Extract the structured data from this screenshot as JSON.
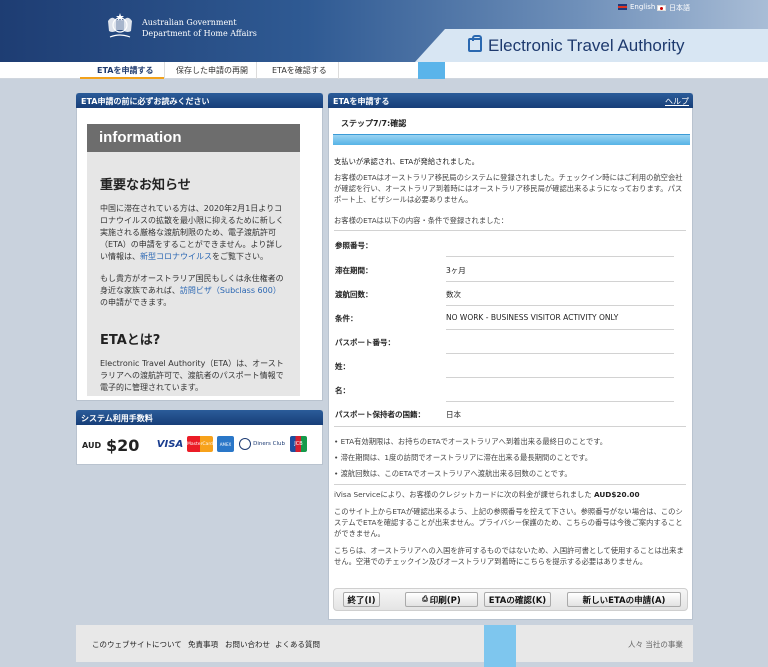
{
  "header": {
    "gov_line1": "Australian Government",
    "gov_line2": "Department of Home Affairs",
    "lang_en": "English",
    "lang_ja": "日本語",
    "app_title": "Electronic Travel Authority"
  },
  "nav": {
    "items": [
      "ETAを申請する",
      "保存した申請の再開",
      "ETAを確認する"
    ]
  },
  "left": {
    "panel_title": "ETA申請の前に必ずお読みください",
    "banner": "information",
    "notice_heading": "重要なお知らせ",
    "notice_p1": "中国に滞在されている方は、2020年2月1日よりコロナウイルスの拡散を最小限に抑えるために新しく実施される厳格な渡航制限のため、電子渡航許可（ETA）の申請をすることができません。より詳しい情報は、",
    "notice_link1": "新型コロナウイルス",
    "notice_p1_end": "をご覧下さい。",
    "notice_p2": "もし貴方がオーストラリア国民もしくは永住権者の身近な家族であれば、",
    "notice_link2": "訪問ビザ（Subclass 600）",
    "notice_p2_end": "の申請ができます。",
    "eta_heading": "ETAとは?",
    "eta_p": "Electronic Travel Authority（ETA）は、オーストラリアへの渡航許可で、渡航者のパスポート情報で電子的に管理されています。"
  },
  "fee": {
    "panel_title": "システム利用手数料",
    "currency": "AUD",
    "amount": "$20",
    "cards": [
      "VISA",
      "MasterCard",
      "AMEX",
      "Diners Club",
      "JCB"
    ]
  },
  "right": {
    "panel_title": "ETAを申請する",
    "help": "ヘルプ",
    "step": "ステップ7/7:確認",
    "progress_percent": 100,
    "msg_approved": "支払いが承認され、ETAが発給されました。",
    "msg_registered": "お客様のETAはオーストラリア移民局のシステムに登録されました。チェックイン時にはご利用の航空会社が確認を行い、オーストラリア到着時にはオーストラリア移民局が確認出来るようになっております。パスポート上、ビザシールは必要ありません。",
    "msg_conditions": "お客様のETAは以下の内容・条件で登録されました：",
    "rows": [
      {
        "label": "参照番号：",
        "value": ""
      },
      {
        "label": "滞在期間：",
        "value": "3ヶ月"
      },
      {
        "label": "渡航回数：",
        "value": "数次"
      },
      {
        "label": "条件：",
        "value": "NO WORK - BUSINESS VISITOR ACTIVITY ONLY"
      },
      {
        "label": "パスポート番号：",
        "value": ""
      },
      {
        "label": "姓：",
        "value": ""
      },
      {
        "label": "名：",
        "value": ""
      },
      {
        "label": "パスポート保持者の国籍：",
        "value": "日本"
      }
    ],
    "bullets": [
      "ETA有効期限は、お持ちのETAでオーストラリアへ到着出来る最終日のことです。",
      "滞在期間は、1度の訪問でオーストラリアに滞在出来る最長期間のことです。",
      "渡航回数は、このETAでオーストラリアへ渡航出来る回数のことです。"
    ],
    "charge_text": "iVisa Serviceにより、お客様のクレジットカードに次の料金が課せられました",
    "charge_amount": "AUD$20.00",
    "note1": "このサイト上からETAが確認出来るよう、上記の参照番号を控えて下さい。参照番号がない場合は、このシステムでETAを確認することが出来ません。プライバシー保護のため、こちらの番号は今後ご案内することができません。",
    "note2": "こちらは、オーストラリアへの入国を許可するものではないため、入国許可書として使用することは出来ません。空港でのチェックイン及びオーストラリア到着時にこちらを提示する必要はありません。",
    "buttons": [
      "終了(I)",
      "印刷(P)",
      "ETAの確認(K)",
      "新しいETAの申請(A)"
    ]
  },
  "footer": {
    "links": [
      "このウェブサイトについて",
      "免責事項",
      "お問い合わせ",
      "よくある質問"
    ],
    "right_text": "人々 当社の事業"
  }
}
